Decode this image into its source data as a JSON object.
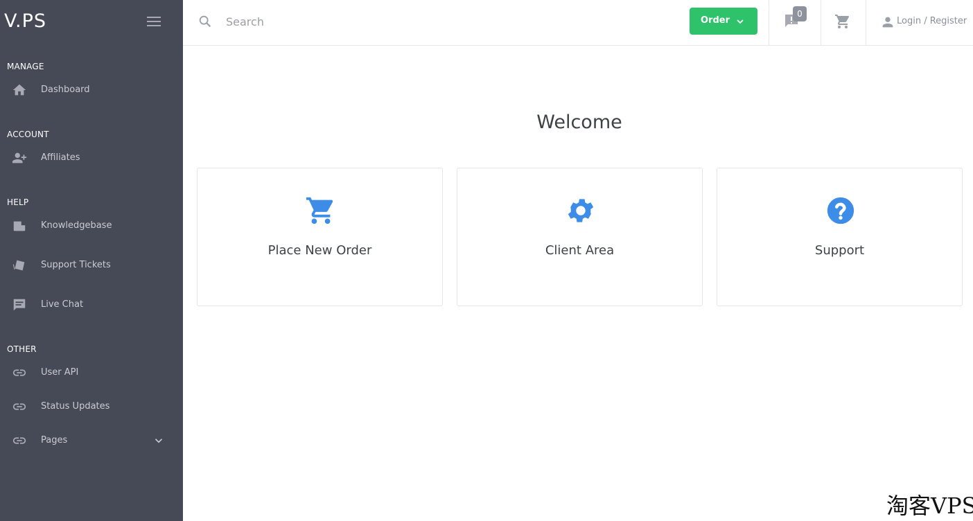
{
  "brand": {
    "logo": "V.PS"
  },
  "sidebar": {
    "sections": [
      {
        "label": "MANAGE"
      },
      {
        "label": "ACCOUNT"
      },
      {
        "label": "HELP"
      },
      {
        "label": "OTHER"
      }
    ],
    "items": [
      {
        "label": "Dashboard",
        "icon": "home-icon"
      },
      {
        "label": "Affiliates",
        "icon": "add-user-icon"
      },
      {
        "label": "Knowledgebase",
        "icon": "folder-icon"
      },
      {
        "label": "Support Tickets",
        "icon": "tickets-icon"
      },
      {
        "label": "Live Chat",
        "icon": "chat-icon"
      },
      {
        "label": "User API",
        "icon": "link-icon"
      },
      {
        "label": "Status Updates",
        "icon": "link-icon"
      },
      {
        "label": "Pages",
        "icon": "link-icon"
      }
    ]
  },
  "topbar": {
    "search_placeholder": "Search",
    "order_label": "Order",
    "notifications_count": "0",
    "login_label": "Login / Register"
  },
  "main": {
    "welcome": "Welcome",
    "cards": [
      {
        "title": "Place New Order",
        "icon": "cart-icon"
      },
      {
        "title": "Client Area",
        "icon": "gear-icon"
      },
      {
        "title": "Support",
        "icon": "question-icon"
      }
    ]
  },
  "watermark": "淘客VPS",
  "colors": {
    "sidebar_bg": "#464a57",
    "accent_green": "#2ec26a",
    "icon_blue": "#3d8de8"
  }
}
